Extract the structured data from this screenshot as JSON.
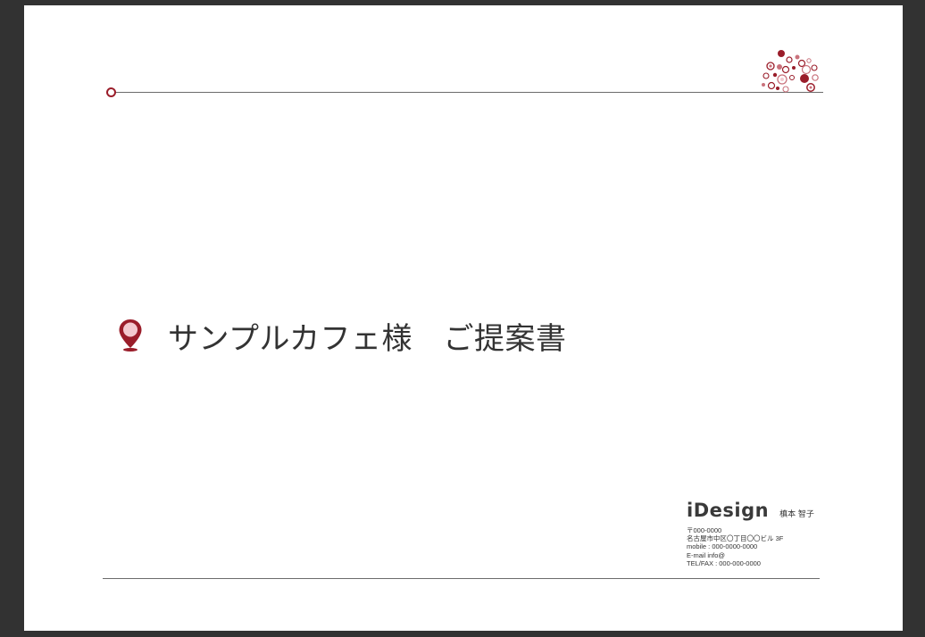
{
  "slide": {
    "title": "サンプルカフェ様　ご提案書"
  },
  "brand": {
    "logo": "iDesign",
    "person": "槙本 智子",
    "contact": [
      "〒000-0000",
      "名古屋市中区〇丁目〇〇ビル 3F",
      "mobile : 000-0000-0000",
      "E-mail info@",
      "TEL/FAX : 000-000-0000"
    ]
  },
  "colors": {
    "accent": "#9a1d2a",
    "accent_light": "#f3c9cf",
    "rule": "#6b6b6b",
    "text": "#333333"
  },
  "icons": {
    "title_marker": "map-pin-icon",
    "decoration": "bubbles-decoration"
  }
}
